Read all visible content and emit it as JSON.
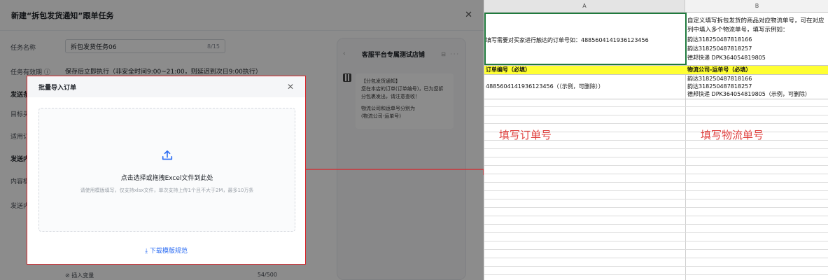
{
  "task_dialog": {
    "title": "新建“拆包发货通知”跟单任务",
    "close_icon": "close-icon",
    "task_name_label": "任务名称",
    "task_name_value": "拆包发货任务06",
    "task_name_count": "8/15",
    "validity_label": "任务有效期",
    "validity_value": "保存后立即执行（非安全时间9:00~21:00，则延迟到次日9:00执行）",
    "section_send_condition": "发送条",
    "target_label": "目标买",
    "applicable_label": "适用订",
    "section_send_content": "发送内",
    "content_label": "内容模",
    "send_label": "发送内",
    "insert_variable": "插入变量",
    "content_count": "54/500"
  },
  "preview": {
    "shop_name": "客服平台专属测试店铺",
    "message_lines": [
      "【分包发货通知】",
      "您在本店的订单(订单编号)，已为您拆分包裹发出，请注意查收！",
      "物流公司和运单号分别为",
      "(物流公司-运单号)"
    ]
  },
  "import_modal": {
    "title": "批量导入订单",
    "upload_text": "点击选择或拖拽Excel文件到此处",
    "upload_hint": "请使用模版填写，仅支持xlsx文件，单次支持上传1个且不大于2M，最多10万条",
    "download_link": "下载模版规范",
    "accent_color": "#2b6cf3",
    "highlight_color": "#d9262b"
  },
  "sheet": {
    "columns": [
      "A",
      "B"
    ],
    "row1_a": "填写需要对买家进行触达的订单号如：4885604141936123456",
    "row1_b_lines": [
      "自定义填写拆包发货的商品对应物流单号，可在对应列中填入多个物流单号，填写示例如：",
      "韵达318250487818166",
      "韵达318250487818257",
      "德邦快递 DPK364054819805"
    ],
    "header_a": "订单编号（必填）",
    "header_b": "物流公司-运单号（必填）",
    "example_a": "4885604141936123456（（示例，可删除））",
    "example_b_lines": [
      "韵达318250487818166",
      "韵达318250487818257",
      "德邦快递 DPK364054819805（示例，可删除）"
    ],
    "annotation_a": "填写订单号",
    "annotation_b": "填写物流单号",
    "header_fill": "#ffff33",
    "annotation_color": "#e0413f"
  }
}
